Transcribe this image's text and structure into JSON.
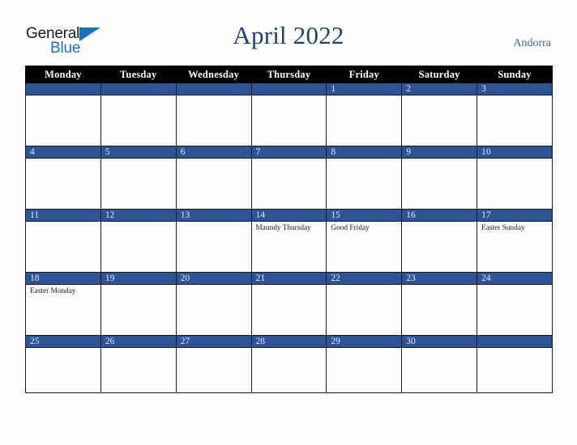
{
  "brand": {
    "word_one": "General",
    "word_two": "Blue",
    "triangle_icon": "triangle-right-icon",
    "colors": {
      "dark": "#1d1d1d",
      "blue": "#1b72b8"
    }
  },
  "header": {
    "title": "April 2022",
    "region": "Andorra",
    "title_color": "#22416c",
    "region_color": "#4d6489"
  },
  "calendar": {
    "month": "April",
    "year": "2022",
    "week_start": "Monday",
    "weekday_headers": [
      "Monday",
      "Tuesday",
      "Wednesday",
      "Thursday",
      "Friday",
      "Saturday",
      "Sunday"
    ],
    "colors": {
      "header_background": "#000000",
      "header_text": "#ffffff",
      "date_bar": "#2f5496",
      "date_text": "#e8e8ef",
      "cell_background": "#fdfdfd",
      "grid_line": "#1a1a1a"
    },
    "weeks": [
      [
        {
          "date": "",
          "events": []
        },
        {
          "date": "",
          "events": []
        },
        {
          "date": "",
          "events": []
        },
        {
          "date": "",
          "events": []
        },
        {
          "date": "1",
          "events": []
        },
        {
          "date": "2",
          "events": []
        },
        {
          "date": "3",
          "events": []
        }
      ],
      [
        {
          "date": "4",
          "events": []
        },
        {
          "date": "5",
          "events": []
        },
        {
          "date": "6",
          "events": []
        },
        {
          "date": "7",
          "events": []
        },
        {
          "date": "8",
          "events": []
        },
        {
          "date": "9",
          "events": []
        },
        {
          "date": "10",
          "events": []
        }
      ],
      [
        {
          "date": "11",
          "events": []
        },
        {
          "date": "12",
          "events": []
        },
        {
          "date": "13",
          "events": []
        },
        {
          "date": "14",
          "events": [
            "Maundy Thursday"
          ]
        },
        {
          "date": "15",
          "events": [
            "Good Friday"
          ]
        },
        {
          "date": "16",
          "events": []
        },
        {
          "date": "17",
          "events": [
            "Easter Sunday"
          ]
        }
      ],
      [
        {
          "date": "18",
          "events": [
            "Easter Monday"
          ]
        },
        {
          "date": "19",
          "events": []
        },
        {
          "date": "20",
          "events": []
        },
        {
          "date": "21",
          "events": []
        },
        {
          "date": "22",
          "events": []
        },
        {
          "date": "23",
          "events": []
        },
        {
          "date": "24",
          "events": []
        }
      ],
      [
        {
          "date": "25",
          "events": []
        },
        {
          "date": "26",
          "events": []
        },
        {
          "date": "27",
          "events": []
        },
        {
          "date": "28",
          "events": []
        },
        {
          "date": "29",
          "events": []
        },
        {
          "date": "30",
          "events": []
        },
        {
          "date": "",
          "events": []
        }
      ]
    ]
  }
}
